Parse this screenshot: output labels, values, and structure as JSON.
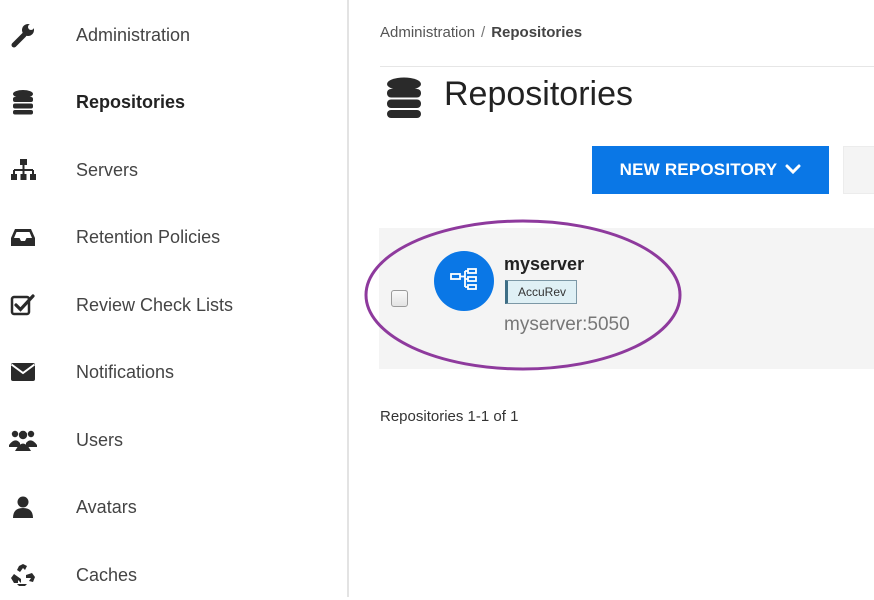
{
  "sidebar": {
    "items": [
      {
        "label": "Administration",
        "icon": "wrench-icon"
      },
      {
        "label": "Repositories",
        "icon": "database-icon",
        "active": true
      },
      {
        "label": "Servers",
        "icon": "sitemap-icon"
      },
      {
        "label": "Retention Policies",
        "icon": "inbox-icon"
      },
      {
        "label": "Review Check Lists",
        "icon": "check-square-icon"
      },
      {
        "label": "Notifications",
        "icon": "envelope-icon"
      },
      {
        "label": "Users",
        "icon": "users-icon"
      },
      {
        "label": "Avatars",
        "icon": "user-icon"
      },
      {
        "label": "Caches",
        "icon": "recycle-icon"
      }
    ]
  },
  "breadcrumb": {
    "parent": "Administration",
    "separator": "/",
    "current": "Repositories"
  },
  "page": {
    "title": "Repositories"
  },
  "toolbar": {
    "new_repository_label": "NEW REPOSITORY"
  },
  "repositories": [
    {
      "name": "myserver",
      "type": "AccuRev",
      "host": "myserver:5050"
    }
  ],
  "pager": {
    "text": "Repositories 1-1 of 1"
  },
  "colors": {
    "accent": "#0a77e6",
    "annotation": "#8e3a9d",
    "row_background": "#f4f4f4"
  }
}
